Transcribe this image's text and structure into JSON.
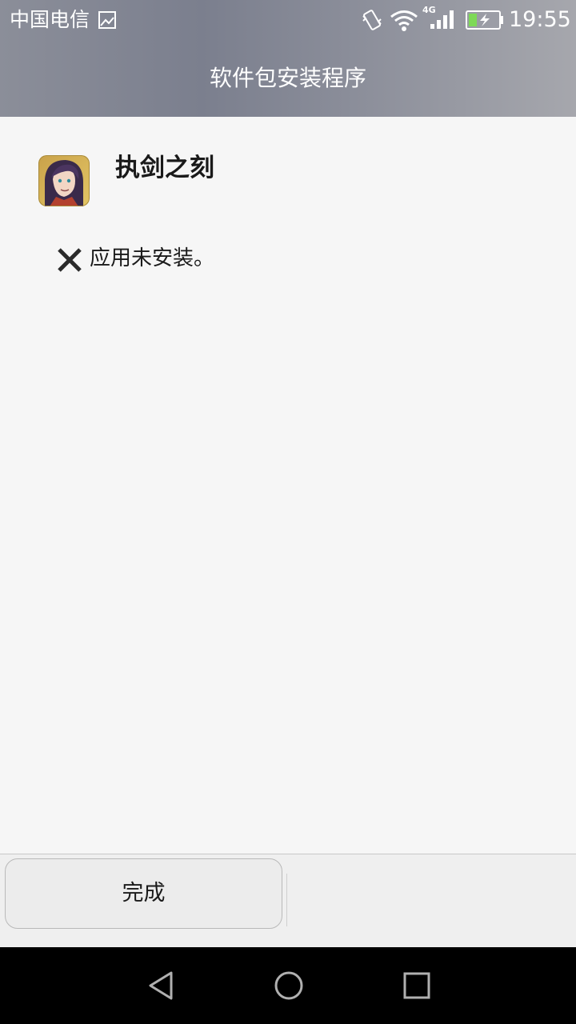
{
  "status_bar": {
    "carrier": "中国电信",
    "network_type": "4G",
    "time": "19:55",
    "icons": [
      "sim-card-icon",
      "vibrate-icon",
      "wifi-icon",
      "cell-signal-icon",
      "battery-charging-icon"
    ]
  },
  "header": {
    "title": "软件包安装程序"
  },
  "app": {
    "name": "执剑之刻",
    "icon": "app-icon"
  },
  "install_status": {
    "icon": "close-x-icon",
    "text": "应用未安装。"
  },
  "buttons": {
    "done_label": "完成"
  },
  "nav": {
    "icons": [
      "back-triangle-icon",
      "home-circle-icon",
      "recents-square-icon"
    ]
  },
  "colors": {
    "header_gradient_start": "#8b8e99",
    "header_gradient_end": "#a6a7ad",
    "content_background": "#f6f6f6",
    "button_bar_background": "#efefef",
    "nav_bar_background": "#000000",
    "text_primary": "#1a1a1a"
  }
}
